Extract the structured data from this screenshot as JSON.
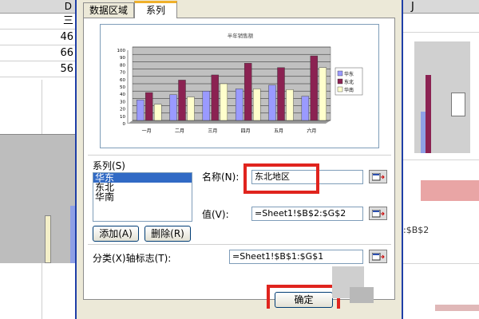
{
  "background": {
    "left_col_header": "D",
    "left_cells": [
      "三",
      "46",
      "66",
      "56"
    ],
    "right_col_header": "J",
    "right_formula": ":$B$2"
  },
  "dialog": {
    "tabs": [
      {
        "label": "数据区域",
        "active": false
      },
      {
        "label": "系列",
        "active": true
      }
    ],
    "series_label": "系列(S)",
    "series_list": [
      "华东",
      "东北",
      "华南"
    ],
    "series_selected": "华东",
    "add_button": "添加(A)",
    "delete_button": "删除(R)",
    "name_label": "名称(N):",
    "name_value": "东北地区",
    "value_label": "值(V):",
    "value_value": "=Sheet1!$B$2:$G$2",
    "category_label": "分类(X)轴标志(T):",
    "category_value": "=Sheet1!$B$1:$G$1",
    "ok_button": "确定"
  },
  "chart_data": {
    "type": "bar",
    "title": "半年销售额",
    "categories": [
      "一月",
      "二月",
      "三月",
      "四月",
      "五月",
      "六月"
    ],
    "ylim": [
      0,
      100
    ],
    "yticks": [
      0,
      10,
      20,
      30,
      40,
      50,
      60,
      70,
      80,
      90,
      100
    ],
    "grid": true,
    "legend_placement": "right",
    "series": [
      {
        "name": "华东",
        "color": "#9a9aff",
        "values": [
          28,
          35,
          40,
          43,
          48,
          33
        ]
      },
      {
        "name": "东北",
        "color": "#8b2252",
        "values": [
          38,
          55,
          62,
          78,
          72,
          88
        ]
      },
      {
        "name": "华南",
        "color": "#ffffcc",
        "values": [
          22,
          32,
          50,
          43,
          42,
          72
        ]
      }
    ]
  },
  "colors": {
    "highlight": "#e0241e",
    "selection": "#316ac5",
    "dialog_bg": "#ece9d8"
  }
}
